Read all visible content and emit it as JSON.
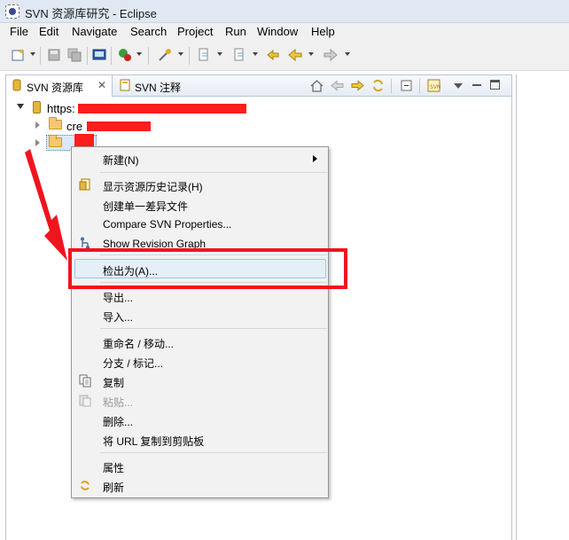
{
  "window": {
    "title": "SVN 资源库研究 - Eclipse"
  },
  "menubar": {
    "items": [
      "File",
      "Edit",
      "Navigate",
      "Search",
      "Project",
      "Run",
      "Window",
      "Help"
    ]
  },
  "tabs": [
    {
      "label": "SVN 资源库",
      "icon": "svn-repository-icon",
      "active": true,
      "closable": true
    },
    {
      "label": "SVN 注释",
      "icon": "svn-annotate-icon",
      "active": false,
      "closable": false
    }
  ],
  "tree": {
    "root": {
      "label": "https:",
      "expanded": true
    },
    "children": [
      {
        "label": "cre",
        "expanded": false
      },
      {
        "label": "",
        "expanded": false,
        "selected": true
      }
    ]
  },
  "context_menu": {
    "items": [
      {
        "label": "新建(N)",
        "submenu": true
      },
      {
        "separator": true
      },
      {
        "label": "显示资源历史记录(H)",
        "icon": "history-icon"
      },
      {
        "label": "创建单一差异文件"
      },
      {
        "label": "Compare SVN Properties..."
      },
      {
        "label": "Show Revision Graph",
        "icon": "revision-graph-icon"
      },
      {
        "separator": true
      },
      {
        "label": "检出为(A)...",
        "highlighted": true
      },
      {
        "separator": true
      },
      {
        "label": "导出..."
      },
      {
        "label": "导入..."
      },
      {
        "separator": true
      },
      {
        "label": "重命名 / 移动..."
      },
      {
        "label": "分支 / 标记..."
      },
      {
        "label": "复制",
        "icon": "copy-icon"
      },
      {
        "label": "粘贴...",
        "icon": "paste-icon",
        "disabled": true
      },
      {
        "label": "删除..."
      },
      {
        "label": "将 URL 复制到剪贴板"
      },
      {
        "separator": true
      },
      {
        "label": "属性"
      },
      {
        "label": "刷新",
        "icon": "refresh-icon"
      }
    ]
  },
  "colors": {
    "annotation": "#f0141e",
    "redaction": "#ff1d1d",
    "highlight": "#e5effa"
  }
}
